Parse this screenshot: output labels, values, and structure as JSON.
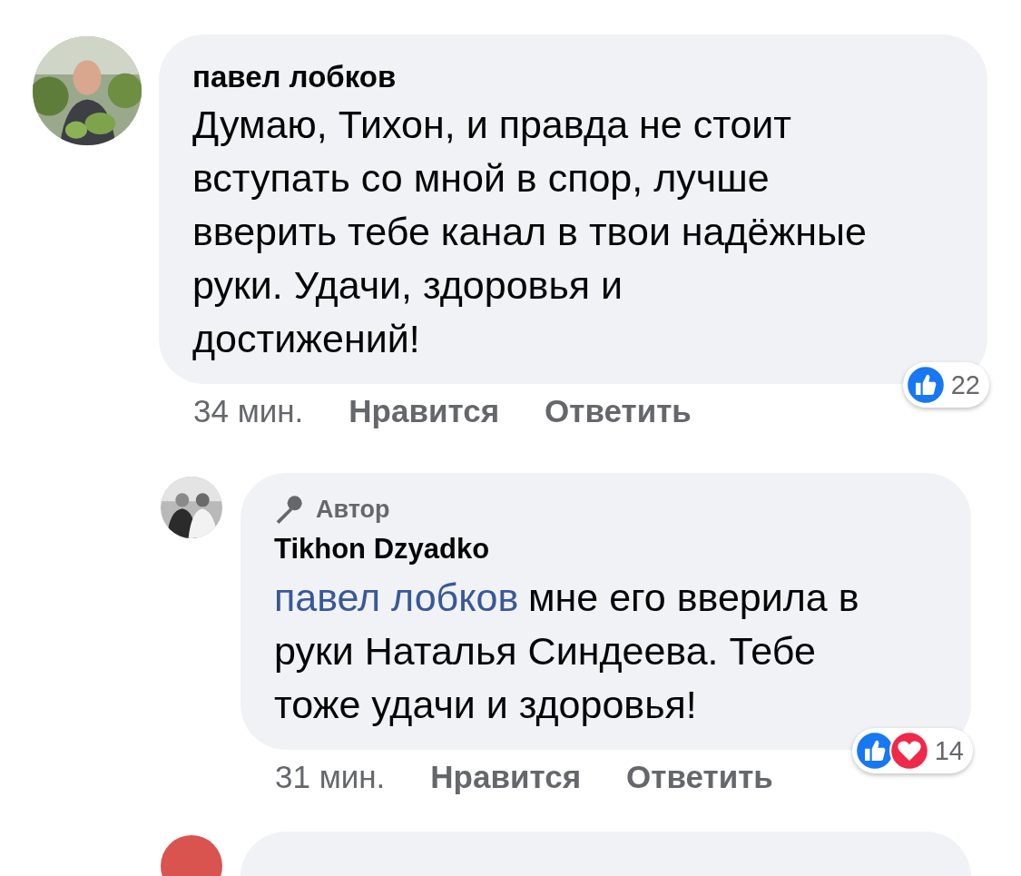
{
  "comments": [
    {
      "is_reply": false,
      "author": "павел лобков",
      "text": "Думаю, Тихон, и правда не стоит\nвступать со мной в спор, лучше\nвверить тебе канал в твои надёжные\nруки. Удачи, здоровья и\nдостижений!",
      "time": "34 мин.",
      "like_label": "Нравится",
      "reply_label": "Ответить",
      "reactions": [
        {
          "kind": "like"
        }
      ],
      "reaction_count": "22"
    },
    {
      "is_reply": true,
      "badge": "Автор",
      "author": "Tikhon Dzyadko",
      "mention": "павел лобков",
      "text": "мне его вверила в\nруки Наталья Синдеева. Тебе\nтоже удачи и здоровья!",
      "time": "31 мин.",
      "like_label": "Нравится",
      "reply_label": "Ответить",
      "reactions": [
        {
          "kind": "like"
        },
        {
          "kind": "love"
        }
      ],
      "reaction_count": "14"
    }
  ]
}
